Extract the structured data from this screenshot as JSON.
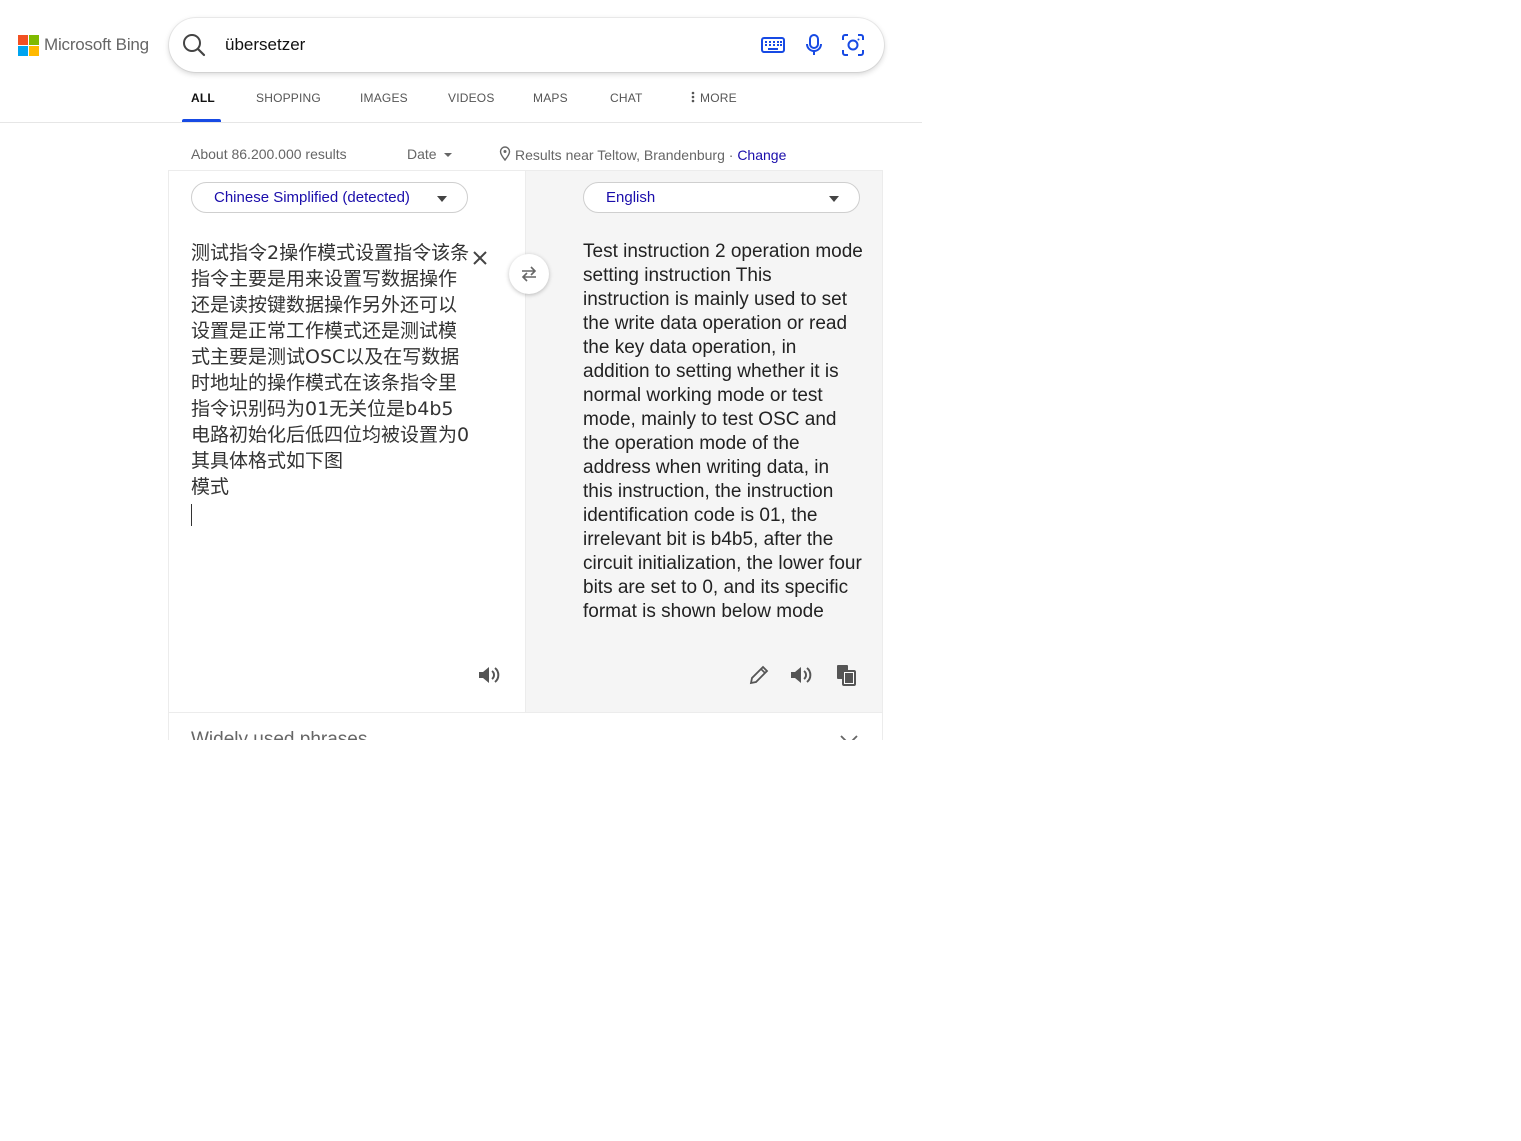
{
  "brand": {
    "name": "Microsoft Bing",
    "logo_colors": [
      "#f25022",
      "#7fba00",
      "#00a4ef",
      "#ffb900"
    ]
  },
  "search": {
    "query": "übersetzer",
    "icons": [
      "search-icon",
      "keyboard-icon",
      "microphone-icon",
      "visual-search-icon"
    ]
  },
  "tabs": [
    {
      "label": "ALL",
      "active": true
    },
    {
      "label": "SHOPPING",
      "active": false
    },
    {
      "label": "IMAGES",
      "active": false
    },
    {
      "label": "VIDEOS",
      "active": false
    },
    {
      "label": "MAPS",
      "active": false
    },
    {
      "label": "CHAT",
      "active": false
    },
    {
      "label": "MORE",
      "active": false
    }
  ],
  "results_meta": {
    "count": "About 86.200.000 results",
    "date_filter": "Date",
    "location": "Results near Teltow, Brandenburg ·",
    "change_label": "Change"
  },
  "translator": {
    "source_language": "Chinese Simplified (detected)",
    "target_language": "English",
    "source_text": "测试指令2操作模式设置指令该条指令主要是用来设置写数据操作还是读按键数据操作另外还可以设置是正常工作模式还是测试模式主要是测试OSC以及在写数据时地址的操作模式在该条指令里指令识别码为01无关位是b4b5电路初始化后低四位均被设置为0其具体格式如下图\n模式",
    "target_text": "Test instruction 2 operation mode setting instruction This instruction is mainly used to set the write data operation or read the key data operation, in addition to setting whether it is normal working mode or test mode, mainly to test OSC and the operation mode of the address when writing data, in this instruction, the instruction identification code is 01, the irrelevant bit is b4b5, after the circuit initialization, the lower four bits are set to 0, and its specific format is shown below mode",
    "phrases_label": "Widely used phrases",
    "accent_color": "#1a0dab"
  }
}
